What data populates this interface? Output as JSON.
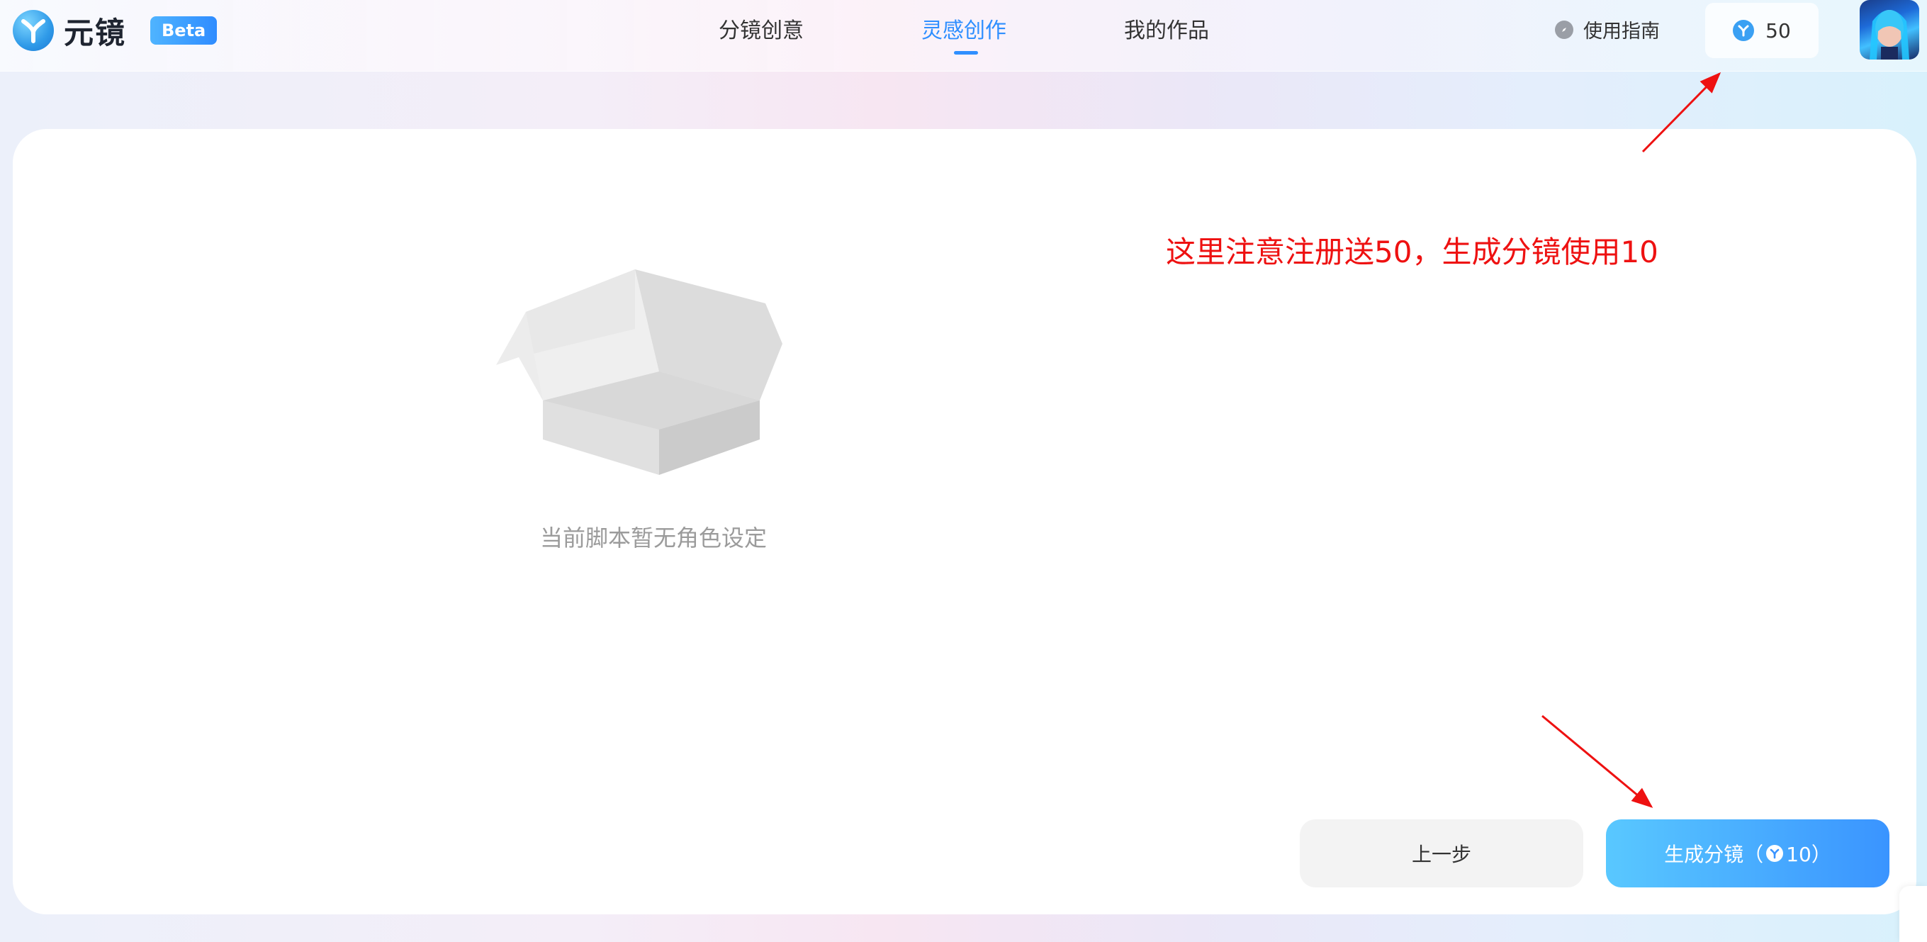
{
  "brand": {
    "name": "元镜",
    "badge": "Beta"
  },
  "nav": {
    "tabs": [
      {
        "label": "分镜创意"
      },
      {
        "label": "灵感创作",
        "active": true
      },
      {
        "label": "我的作品"
      }
    ]
  },
  "header": {
    "guide_label": "使用指南",
    "credits": "50",
    "guide_icon": "compass-icon",
    "credits_icon": "brand-y-icon"
  },
  "main": {
    "empty_text": "当前脚本暂无角色设定",
    "empty_icon": "open-box-illustration"
  },
  "annotation": {
    "text": "这里注意注册送50，生成分镜使用10",
    "color": "#ee1111"
  },
  "actions": {
    "prev_label": "上一步",
    "generate_label": "生成分镜（",
    "generate_cost": "10）"
  },
  "colors": {
    "accent": "#2f8fff",
    "annotation": "#ee1111"
  }
}
